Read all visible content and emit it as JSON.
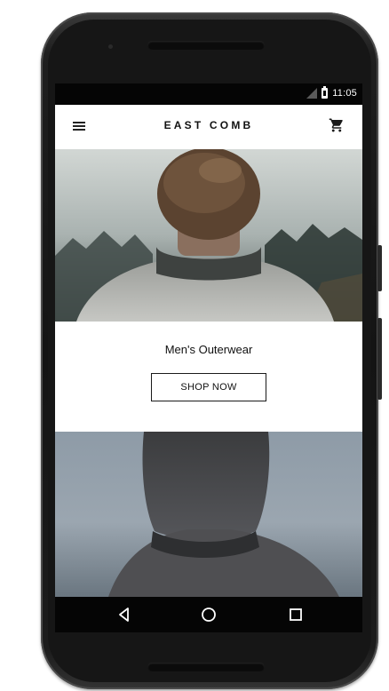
{
  "status_bar": {
    "time": "11:05",
    "icons": [
      "signal-icon",
      "battery-icon"
    ]
  },
  "app_bar": {
    "title": "EAST COMB",
    "icons": [
      "menu-icon",
      "cart-icon"
    ]
  },
  "promo": {
    "title": "Men's Outerwear",
    "button_label": "SHOP NOW"
  },
  "nav_bar": {
    "icons": [
      "back-icon",
      "home-icon",
      "recent-apps-icon"
    ]
  },
  "colors": {
    "status_bar_bg": "#050505",
    "text": "#111111",
    "button_border": "#1a1a1a",
    "background": "#ffffff"
  }
}
